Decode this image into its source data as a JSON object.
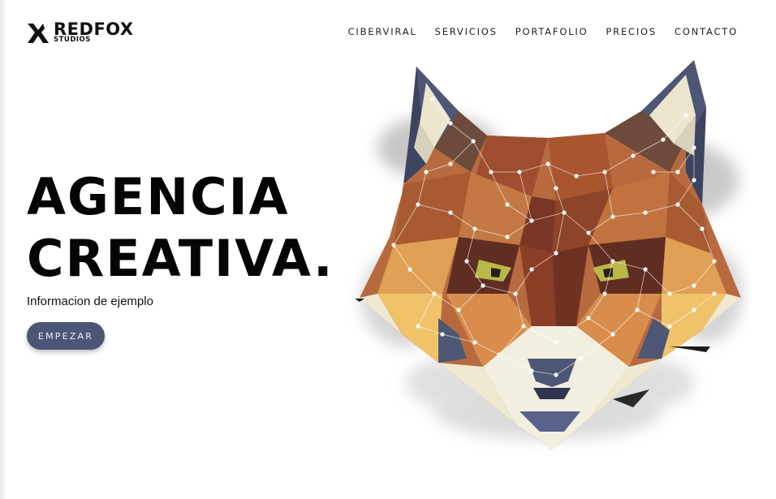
{
  "brand": {
    "name": "REDFOX",
    "sub": "STUDIOS"
  },
  "nav": {
    "items": [
      "CIBERVIRAL",
      "SERVICIOS",
      "PORTAFOLIO",
      "PRECIOS",
      "CONTACTO"
    ]
  },
  "hero": {
    "title_line1": "AGENCIA",
    "title_line2": "CREATIVA.",
    "subtitle": "Informacion de ejemplo",
    "cta_label": "EMPEZAR"
  },
  "illustration": {
    "subject": "low-poly-fox-head"
  },
  "colors": {
    "cta_background": "#4b5677",
    "fox_rust": "#a34f2b",
    "fox_navy": "#4a5270",
    "fox_cream": "#efe9d2"
  }
}
